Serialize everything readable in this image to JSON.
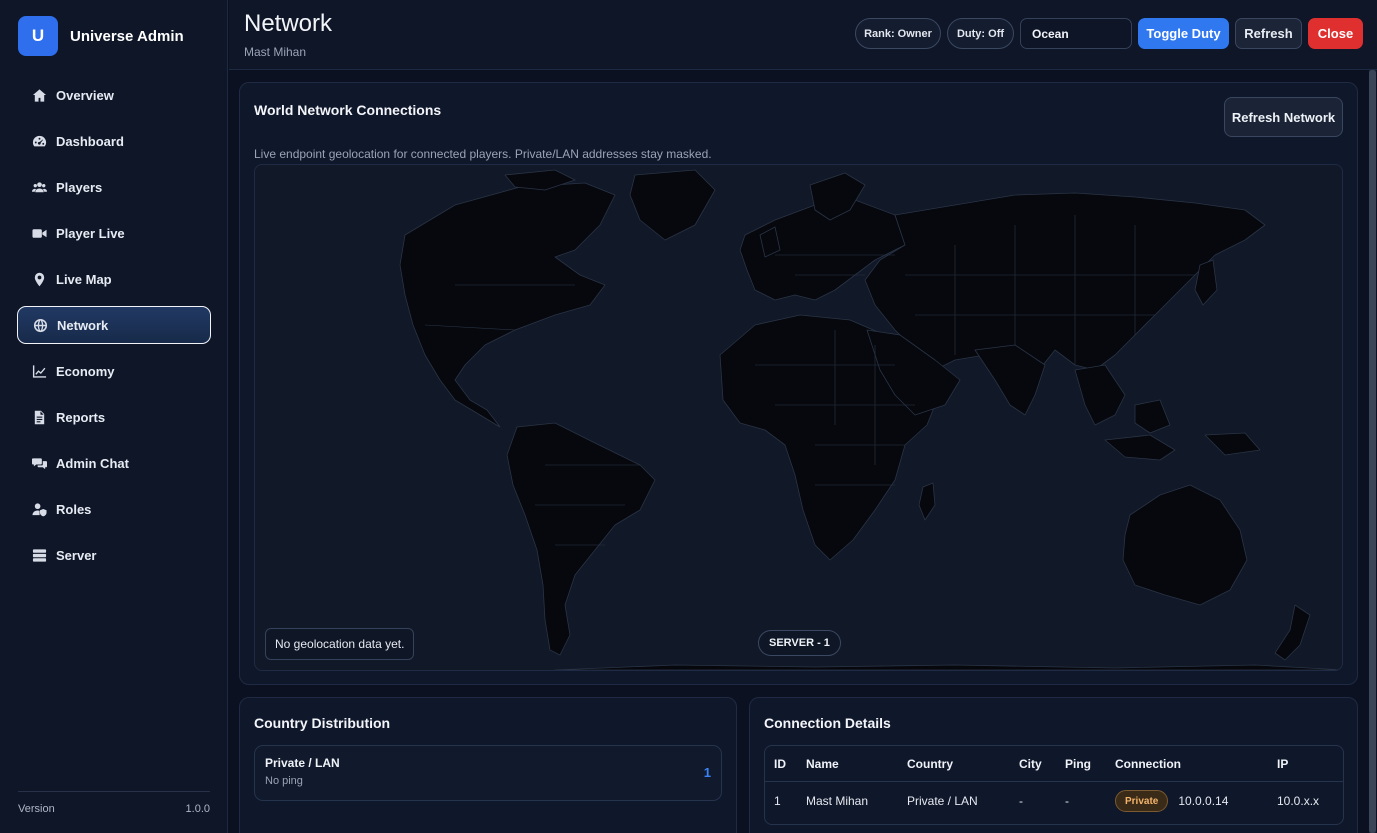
{
  "brand": {
    "logo": "U",
    "name": "Universe Admin"
  },
  "sidebar": {
    "items": [
      {
        "label": "Overview",
        "icon": "home-icon"
      },
      {
        "label": "Dashboard",
        "icon": "gauge-icon"
      },
      {
        "label": "Players",
        "icon": "users-icon"
      },
      {
        "label": "Player Live",
        "icon": "video-camera-icon"
      },
      {
        "label": "Live Map",
        "icon": "map-pin-icon"
      },
      {
        "label": "Network",
        "icon": "globe-icon",
        "active": true
      },
      {
        "label": "Economy",
        "icon": "line-chart-icon"
      },
      {
        "label": "Reports",
        "icon": "document-icon"
      },
      {
        "label": "Admin Chat",
        "icon": "chat-bubbles-icon"
      },
      {
        "label": "Roles",
        "icon": "user-shield-icon"
      },
      {
        "label": "Server",
        "icon": "server-icon"
      }
    ],
    "version_label": "Version",
    "version_value": "1.0.0"
  },
  "header": {
    "title": "Network",
    "subtitle": "Mast Mihan",
    "rank": "Rank: Owner",
    "duty": "Duty: Off",
    "select_value": "Ocean",
    "toggle_duty": "Toggle Duty",
    "refresh": "Refresh",
    "close": "Close"
  },
  "network_panel": {
    "title": "World Network Connections",
    "refresh_button": "Refresh Network",
    "description": "Live endpoint geolocation for connected players. Private/LAN addresses stay masked.",
    "map_note": "No geolocation data yet.",
    "server_label": "SERVER - 1"
  },
  "country_panel": {
    "title": "Country Distribution",
    "items": [
      {
        "name": "Private / LAN",
        "sub": "No ping",
        "count": "1"
      }
    ]
  },
  "connection_panel": {
    "title": "Connection Details",
    "columns": [
      "ID",
      "Name",
      "Country",
      "City",
      "Ping",
      "Connection",
      "IP"
    ],
    "rows": [
      {
        "id": "1",
        "name": "Mast Mihan",
        "country": "Private / LAN",
        "city": "-",
        "ping": "-",
        "badge": "Private",
        "connection": "10.0.0.14",
        "ip": "10.0.x.x"
      }
    ]
  },
  "colors": {
    "accent": "#2f78f0",
    "danger": "#e02f2f",
    "background": "#0b1120",
    "private_badge": "#f3b46a"
  }
}
